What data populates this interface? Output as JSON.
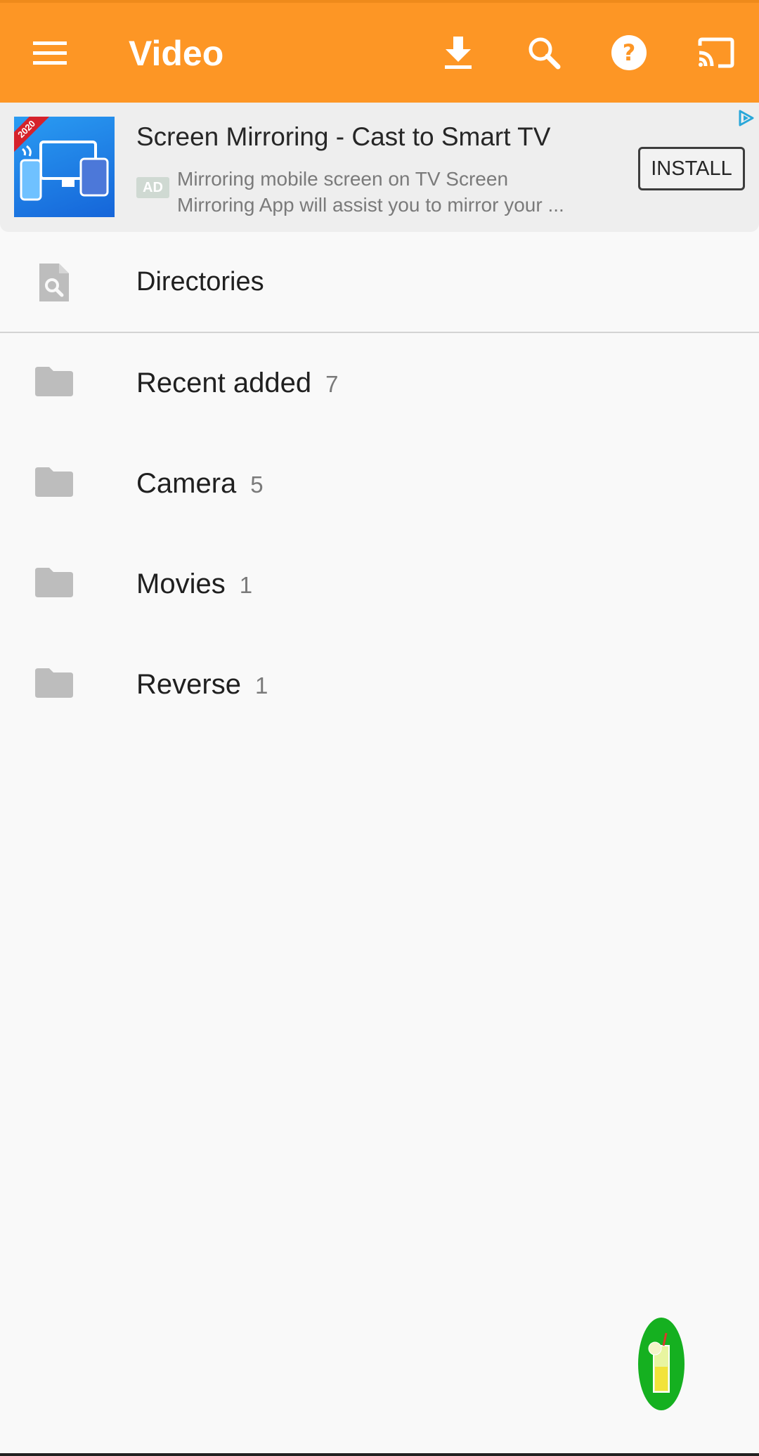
{
  "app_bar": {
    "title": "Video",
    "background": "#fd9625",
    "icons": [
      "menu-icon",
      "download-icon",
      "search-icon",
      "help-icon",
      "cast-icon"
    ]
  },
  "ad": {
    "title": "Screen Mirroring - Cast to Smart TV",
    "label": "AD",
    "description_line1": "Mirroring mobile screen on TV Screen",
    "description_line2": "Mirroring App will assist you to mirror your ...",
    "install_label": "INSTALL",
    "thumbnail_badge": "2020"
  },
  "directories": {
    "label": "Directories"
  },
  "folders": [
    {
      "name": "Recent added",
      "count": "7"
    },
    {
      "name": "Camera",
      "count": "5"
    },
    {
      "name": "Movies",
      "count": "1"
    },
    {
      "name": "Reverse",
      "count": "1"
    }
  ],
  "colors": {
    "accent": "#fd9625",
    "fab": "#15b020",
    "folder_icon": "#bdbdbd"
  }
}
